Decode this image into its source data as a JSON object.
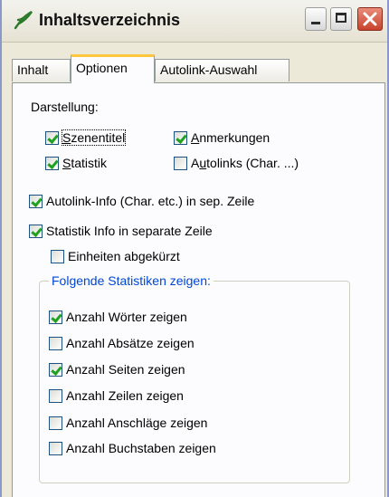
{
  "window": {
    "title": "Inhaltsverzeichnis",
    "icon": "quill-icon"
  },
  "tabs": [
    {
      "label": "Inhalt",
      "selected": false
    },
    {
      "label": "Optionen",
      "selected": true
    },
    {
      "label": "Autolink-Auswahl",
      "selected": false
    }
  ],
  "darstellung": {
    "label": "Darstellung:",
    "options": [
      {
        "label_pre": "",
        "label_u": "S",
        "label_post": "zenentitel",
        "checked": true
      },
      {
        "label_pre": "",
        "label_u": "A",
        "label_post": "nmerkungen",
        "checked": true
      },
      {
        "label_pre": "",
        "label_u": "S",
        "label_post": "tatistik",
        "checked": true
      },
      {
        "label_pre": "A",
        "label_u": "u",
        "label_post": "tolinks (Char. ...)",
        "checked": false
      }
    ]
  },
  "options": [
    {
      "label": "Autolink-Info (Char. etc.) in sep. Zeile",
      "checked": true
    },
    {
      "label": "Statistik Info in separate Zeile",
      "checked": true
    },
    {
      "label": "Einheiten abgekürzt",
      "checked": false
    }
  ],
  "statistics": {
    "legend": "Folgende Statistiken zeigen:",
    "items": [
      {
        "label": "Anzahl Wörter zeigen",
        "checked": true
      },
      {
        "label": "Anzahl Absätze zeigen",
        "checked": false
      },
      {
        "label": "Anzahl Seiten zeigen",
        "checked": true
      },
      {
        "label": "Anzahl Zeilen zeigen",
        "checked": false
      },
      {
        "label": "Anzahl Anschläge zeigen",
        "checked": false
      },
      {
        "label": "Anzahl Buchstaben zeigen",
        "checked": false
      }
    ]
  },
  "colors": {
    "legend_text": "#0046d5",
    "checkmark": "#21a121",
    "active_tab_accent": "#ffc83c",
    "close_button": "#c8432c"
  }
}
